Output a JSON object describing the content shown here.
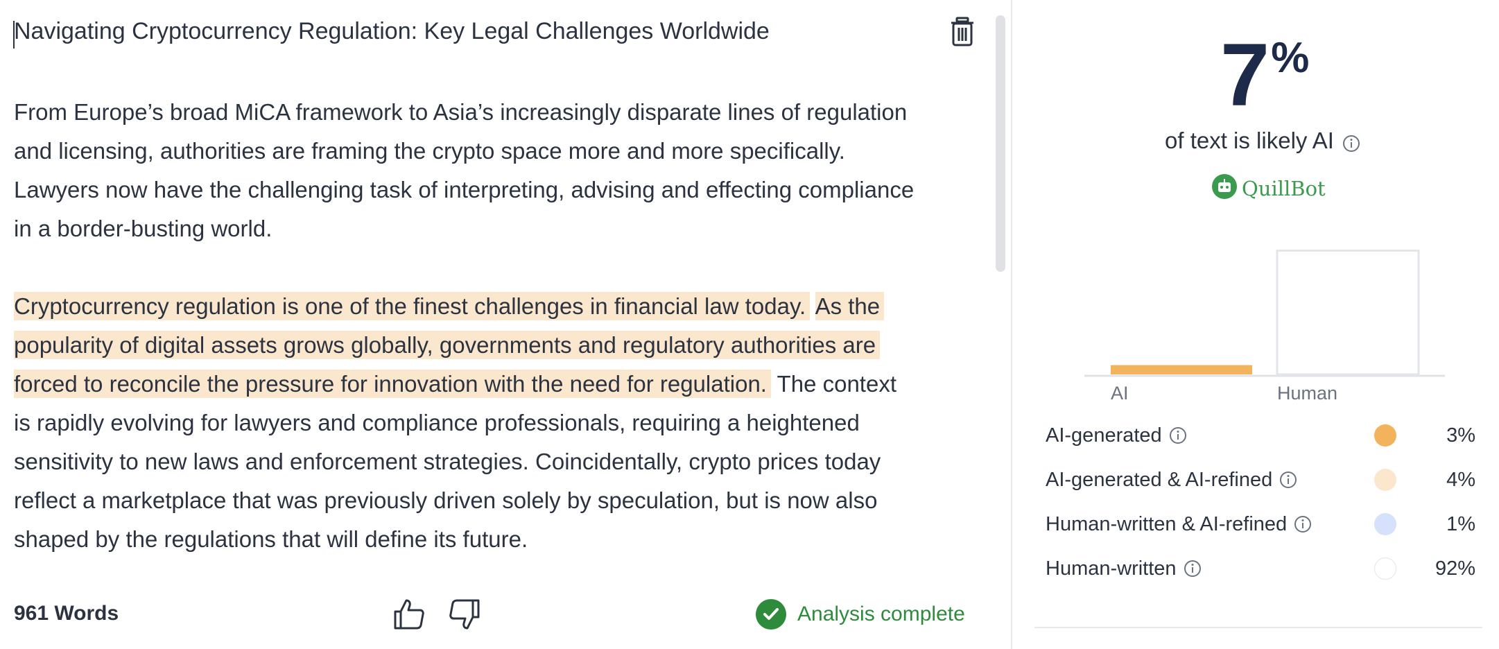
{
  "editor": {
    "title": "Navigating Cryptocurrency Regulation: Key Legal Challenges Worldwide",
    "paragraph1_lines": [
      "From Europe’s broad MiCA framework to Asia’s increasingly disparate lines of regulation",
      "and licensing, authorities are framing the crypto space more and more specifically.",
      "Lawyers now have the challenging task of interpreting, advising and effecting compliance",
      "in a border-busting world."
    ],
    "paragraph2": {
      "line1_hl_a": "Cryptocurrency regulation is one of the finest challenges in financial law today.",
      "line1_hl_b": "As the",
      "line2_hl": "popularity of digital assets grows globally, governments and regulatory authorities are",
      "line3_hl": "forced to reconcile the pressure for innovation with the need for regulation.",
      "line3_rest": " The context",
      "rest_lines": [
        "is rapidly evolving for lawyers and compliance professionals, requiring a heightened",
        "sensitivity to new laws and enforcement strategies. Coincidentally, crypto prices today",
        "reflect a marketplace that was previously driven solely by speculation, but is now also",
        "shaped by the regulations that will define its future."
      ]
    },
    "highlight_color": "#fbe7cd",
    "word_count": "961 Words",
    "status": "Analysis complete",
    "status_color": "#2e8b3c"
  },
  "results": {
    "percent_value": "7",
    "percent_sign": "%",
    "subtitle": "of text is likely AI",
    "brand": "QuillBot",
    "chart_data": {
      "type": "bar",
      "categories": [
        "AI",
        "Human"
      ],
      "values": [
        7,
        93
      ],
      "ylim": [
        0,
        100
      ]
    },
    "legend": [
      {
        "label": "AI-generated",
        "value": "3%",
        "color": "#f2b35c"
      },
      {
        "label": "AI-generated & AI-refined",
        "value": "4%",
        "color": "#fbe7cd"
      },
      {
        "label": "Human-written & AI-refined",
        "value": "1%",
        "color": "#d6e2fb"
      },
      {
        "label": "Human-written",
        "value": "92%",
        "color": "#ffffff"
      }
    ]
  },
  "icons": {
    "delete": "trash-icon",
    "like": "thumbs-up-icon",
    "dislike": "thumbs-down-icon",
    "done": "check-icon",
    "info": "info-icon",
    "logo": "quillbot-logo-icon"
  }
}
